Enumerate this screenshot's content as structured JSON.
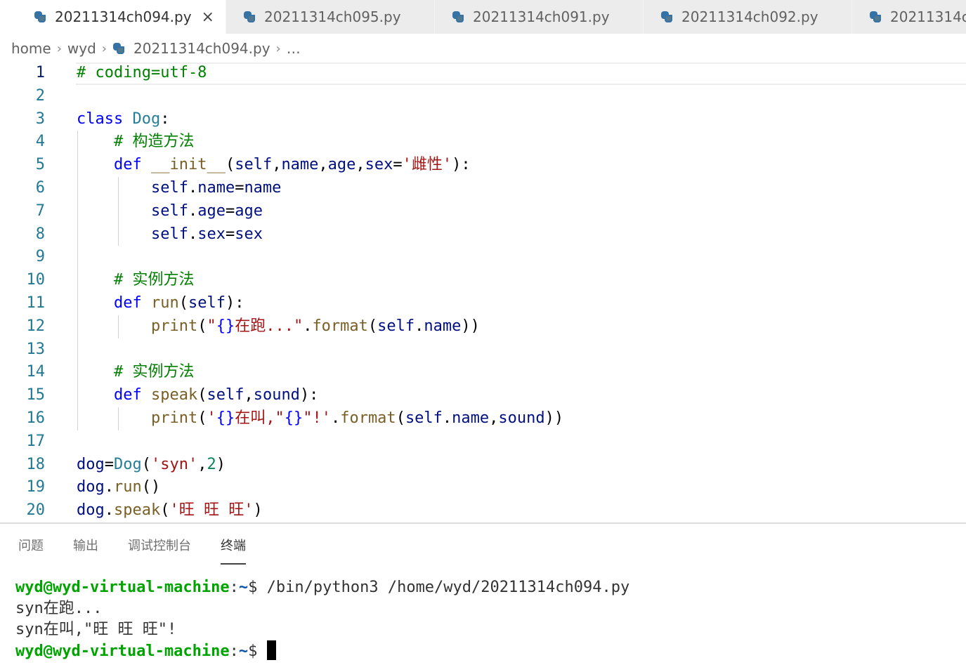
{
  "tabs": [
    {
      "label": "20211314ch094.py",
      "active": true,
      "close_icon": "×"
    },
    {
      "label": "20211314ch095.py",
      "active": false
    },
    {
      "label": "20211314ch091.py",
      "active": false
    },
    {
      "label": "20211314ch092.py",
      "active": false
    },
    {
      "label": "20211314c",
      "active": false
    }
  ],
  "breadcrumb": {
    "home": "home",
    "folder": "wyd",
    "file": "20211314ch094.py",
    "more": "…",
    "sep": "›"
  },
  "editor": {
    "active_line": 1,
    "line_numbers": [
      "1",
      "2",
      "3",
      "4",
      "5",
      "6",
      "7",
      "8",
      "9",
      "10",
      "11",
      "12",
      "13",
      "14",
      "15",
      "16",
      "17",
      "18",
      "19",
      "20"
    ],
    "lines": {
      "l1": "# coding=utf-8",
      "l3_kw": "class",
      "l3_cls": "Dog",
      "l3_p": ":",
      "l4": "# 构造方法",
      "l5_kw": "def",
      "l5_fn": "__init__",
      "l5_a": "(",
      "l5_v1": "self",
      "l5_c1": ",",
      "l5_v2": "name",
      "l5_c2": ",",
      "l5_v3": "age",
      "l5_c3": ",",
      "l5_v4": "sex",
      "l5_eq": "=",
      "l5_str": "'雌性'",
      "l5_end": "):",
      "l6_v": "self",
      "l6_d": ".",
      "l6_a": "name",
      "l6_eq": "=",
      "l6_b": "name",
      "l7_v": "self",
      "l7_d": ".",
      "l7_a": "age",
      "l7_eq": "=",
      "l7_b": "age",
      "l8_v": "self",
      "l8_d": ".",
      "l8_a": "sex",
      "l8_eq": "=",
      "l8_b": "sex",
      "l10": "# 实例方法",
      "l11_kw": "def",
      "l11_fn": "run",
      "l11_a": "(",
      "l11_v": "self",
      "l11_end": "):",
      "l12_fn": "print",
      "l12_a": "(",
      "l12_q": "\"",
      "l12_fmt": "{}",
      "l12_str": "在跑...\"",
      "l12_d": ".",
      "l12_fn2": "format",
      "l12_b": "(",
      "l12_v1": "self",
      "l12_d2": ".",
      "l12_v2": "name",
      "l12_end": "))",
      "l14": "# 实例方法",
      "l15_kw": "def",
      "l15_fn": "speak",
      "l15_a": "(",
      "l15_v1": "self",
      "l15_c": ",",
      "l15_v2": "sound",
      "l15_end": "):",
      "l16_fn": "print",
      "l16_a": "(",
      "l16_q": "'",
      "l16_fmt": "{}",
      "l16_str": "在叫,\"",
      "l16_fmt2": "{}",
      "l16_str2": "\"!'",
      "l16_d": ".",
      "l16_fn2": "format",
      "l16_b": "(",
      "l16_v1": "self",
      "l16_d2": ".",
      "l16_v2": "name",
      "l16_c": ",",
      "l16_v3": "sound",
      "l16_end": "))",
      "l18_v": "dog",
      "l18_eq": "=",
      "l18_cls": "Dog",
      "l18_a": "(",
      "l18_str": "'syn'",
      "l18_c": ",",
      "l18_num": "2",
      "l18_end": ")",
      "l19_v": "dog",
      "l19_d": ".",
      "l19_fn": "run",
      "l19_end": "()",
      "l20_v": "dog",
      "l20_d": ".",
      "l20_fn": "speak",
      "l20_a": "(",
      "l20_str": "'旺 旺 旺'",
      "l20_end": ")"
    }
  },
  "panel": {
    "tabs": [
      "问题",
      "输出",
      "调试控制台",
      "终端"
    ],
    "active_tab": "终端"
  },
  "terminal": {
    "prompt_user": "wyd@wyd-virtual-machine",
    "prompt_colon": ":",
    "prompt_path": "~",
    "prompt_dollar": "$ ",
    "command": "/bin/python3 /home/wyd/20211314ch094.py",
    "output": [
      "syn在跑...",
      "syn在叫,\"旺 旺 旺\"!"
    ]
  },
  "colors": {
    "keyword": "#0000ff",
    "comment": "#008000",
    "class": "#267f99",
    "function": "#795e26",
    "variable": "#001080",
    "string": "#a31515",
    "number": "#098658",
    "terminal_user": "#00a400"
  }
}
